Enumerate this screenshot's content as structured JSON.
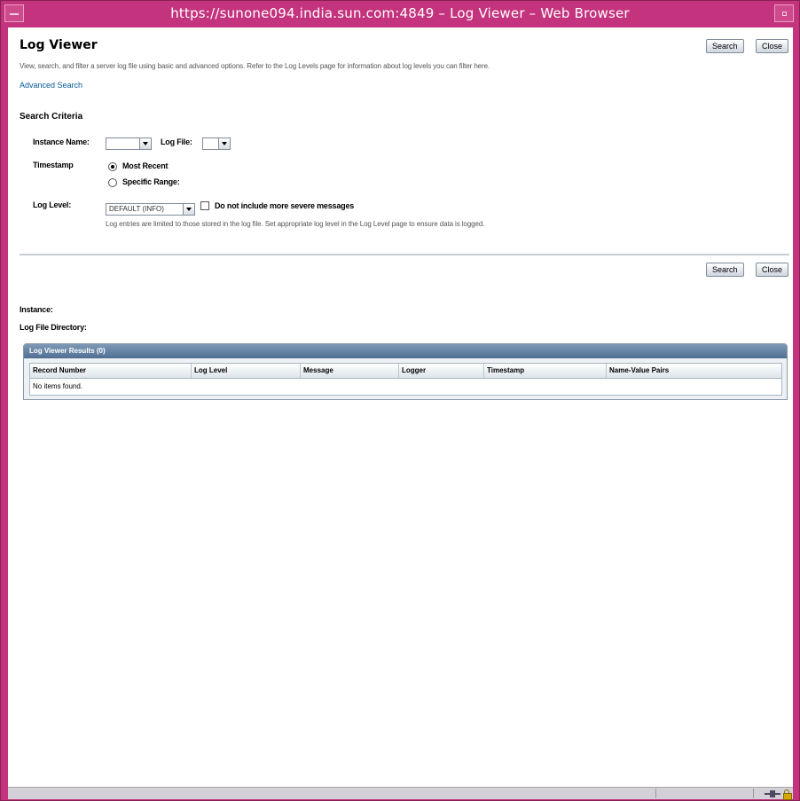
{
  "window": {
    "title": "https://sunone094.india.sun.com:4849 – Log Viewer – Web Browser"
  },
  "page": {
    "title": "Log Viewer",
    "description": "View, search, and filter a server log file using basic and advanced options. Refer to the Log Levels page for information about log levels you can filter here.",
    "advanced_link": "Advanced Search"
  },
  "buttons": {
    "search": "Search",
    "close": "Close"
  },
  "criteria": {
    "title": "Search Criteria",
    "instance_label": "Instance Name:",
    "instance_value": "",
    "logfile_label": "Log File:",
    "logfile_value": "",
    "timestamp_label": "Timestamp",
    "most_recent": "Most Recent",
    "specific_range": "Specific Range:",
    "selected_timestamp": "Most Recent",
    "loglevel_label": "Log Level:",
    "loglevel_value": "DEFAULT (INFO)",
    "exclude_label": "Do not include more severe messages",
    "exclude_checked": false,
    "help": "Log entries are limited to those stored in the log file. Set appropriate log level in the Log Level page to ensure data is logged."
  },
  "info": {
    "instance_label": "Instance:",
    "directory_label": "Log File Directory:"
  },
  "results": {
    "title": "Log Viewer Results (0)",
    "columns": [
      "Record Number",
      "Log Level",
      "Message",
      "Logger",
      "Timestamp",
      "Name-Value Pairs"
    ],
    "empty_text": "No items found."
  }
}
